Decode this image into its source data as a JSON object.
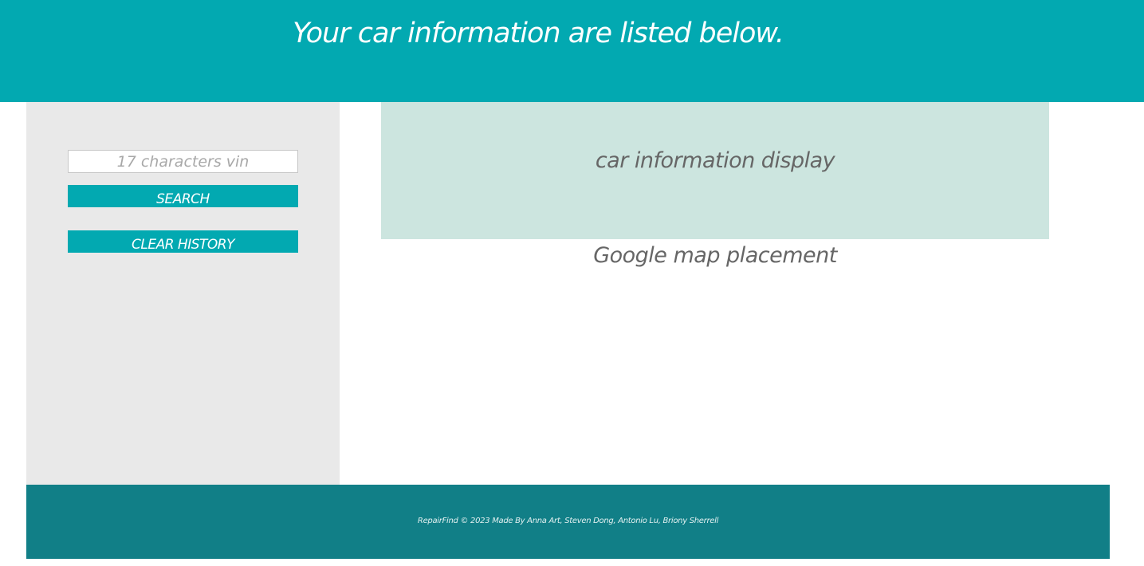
{
  "header": {
    "title": "Your car information are listed below."
  },
  "sidebar": {
    "vin_input": {
      "placeholder": "17 characters vin",
      "value": ""
    },
    "search_label": "SEARCH",
    "clear_history_label": "CLEAR HISTORY"
  },
  "main": {
    "car_display_label": "car information display",
    "map_label": "Google map placement"
  },
  "footer": {
    "text": "RepairFind © 2023 Made By Anna Art, Steven Dong, Antonio Lu, Briony Sherrell"
  },
  "colors": {
    "header_bg": "#02a9b1",
    "button_bg": "#02a9b1",
    "sidebar_bg": "#e9e9e9",
    "car_display_bg": "#cce5df",
    "footer_bg": "#117f87"
  }
}
